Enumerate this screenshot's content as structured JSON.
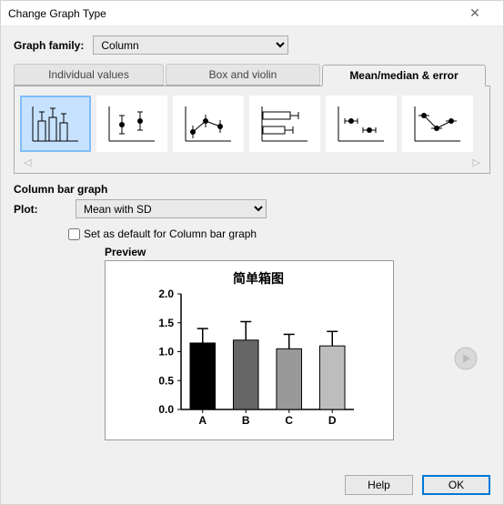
{
  "window": {
    "title": "Change Graph Type"
  },
  "graph_family": {
    "label": "Graph family:",
    "selected": "Column"
  },
  "tabs": [
    {
      "label": "Individual values"
    },
    {
      "label": "Box and violin"
    },
    {
      "label": "Mean/median & error"
    }
  ],
  "selected_chart_label": "Column bar graph",
  "plot": {
    "label": "Plot:",
    "selected": "Mean with SD"
  },
  "default_checkbox": {
    "label": "Set as default for Column bar graph",
    "checked": false
  },
  "preview_label": "Preview",
  "buttons": {
    "help": "Help",
    "ok": "OK"
  },
  "chart_data": {
    "type": "bar",
    "title": "简单箱图",
    "categories": [
      "A",
      "B",
      "C",
      "D"
    ],
    "values": [
      1.15,
      1.2,
      1.05,
      1.1
    ],
    "errors": [
      0.25,
      0.32,
      0.25,
      0.25
    ],
    "colors": [
      "#000000",
      "#666666",
      "#999999",
      "#bdbdbd"
    ],
    "ylim": [
      0.0,
      2.0
    ],
    "yticks": [
      0.0,
      0.5,
      1.0,
      1.5,
      2.0
    ],
    "xlabel": "",
    "ylabel": ""
  }
}
